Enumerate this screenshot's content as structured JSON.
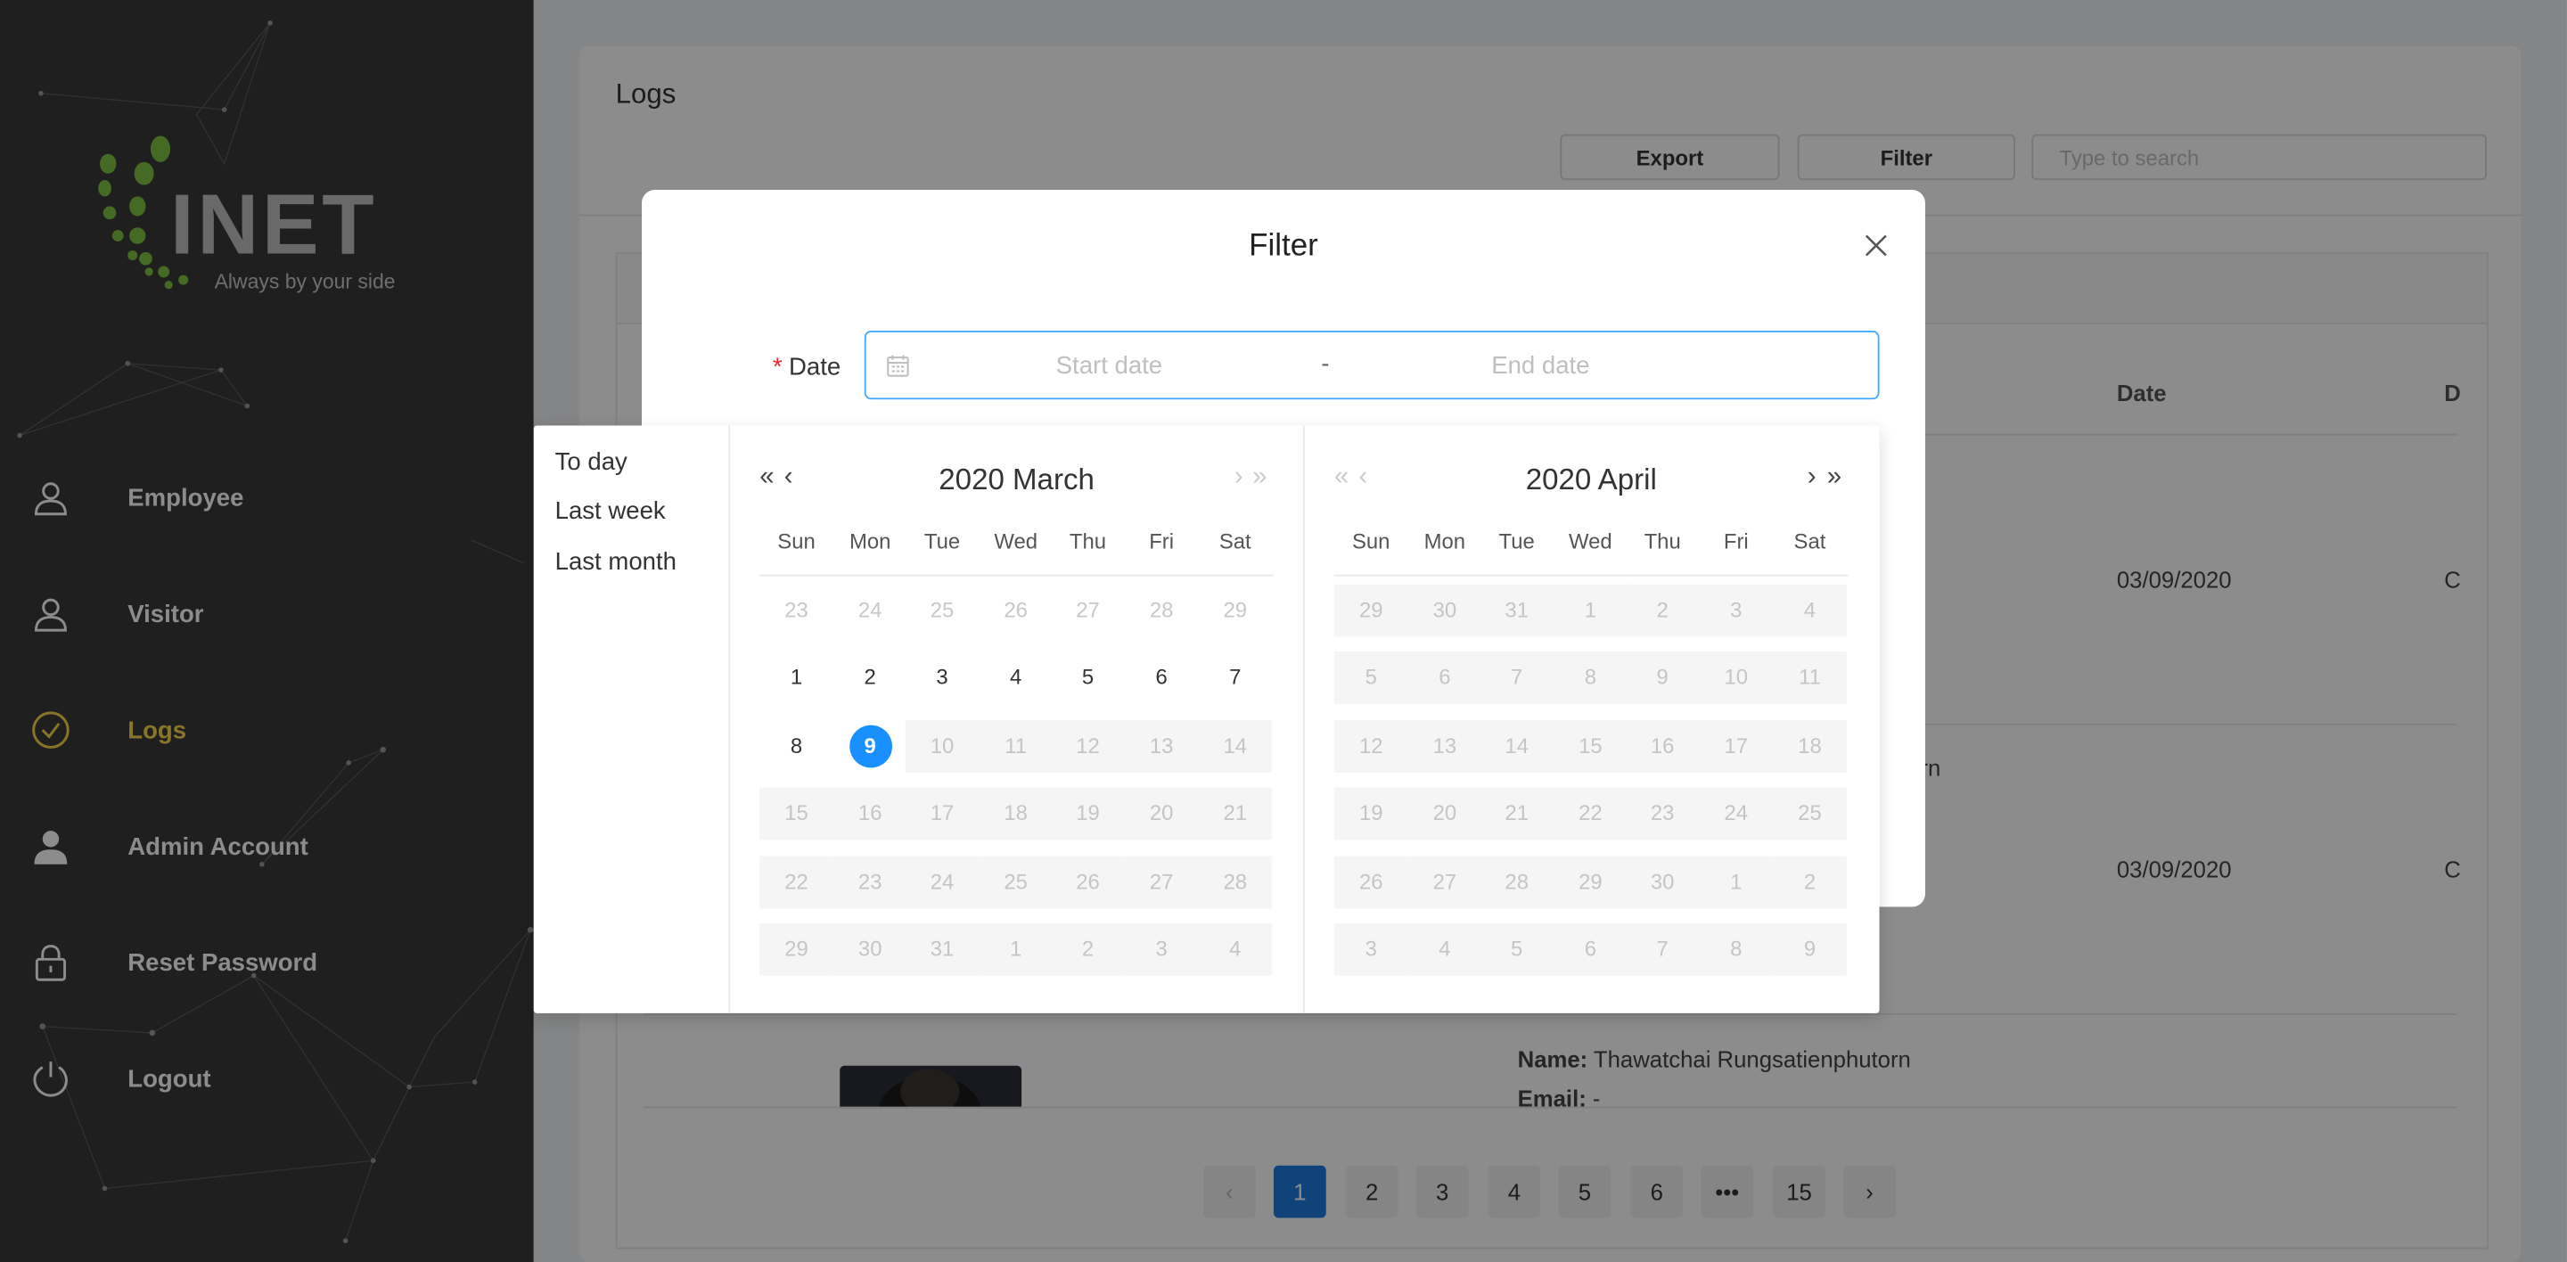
{
  "sidebar": {
    "logo_text": "INET",
    "logo_tagline": "Always by your side",
    "items": [
      {
        "label": "Employee",
        "icon": "user-icon"
      },
      {
        "label": "Visitor",
        "icon": "user-icon"
      },
      {
        "label": "Logs",
        "icon": "check-circle-icon",
        "active": true
      },
      {
        "label": "Admin Account",
        "icon": "admin-user-icon"
      },
      {
        "label": "Reset Password",
        "icon": "lock-icon"
      },
      {
        "label": "Logout",
        "icon": "power-icon"
      }
    ],
    "colors": {
      "background": "#3a3a3a",
      "active": "#f7d64a"
    }
  },
  "page": {
    "title": "Logs",
    "export_label": "Export",
    "filter_label": "Filter",
    "search_placeholder": "Type to search"
  },
  "table": {
    "columns": {
      "date": "Date",
      "d": "D"
    },
    "rows": [
      {
        "date": "03/09/2020",
        "d": "C"
      },
      {
        "date": "03/09/2020",
        "d": "C",
        "name_fragment": "rn"
      },
      {
        "name_label": "Name:",
        "name": "Thawatchai Rungsatienphutorn",
        "email_label": "Email:",
        "email": "-"
      }
    ]
  },
  "pagination": {
    "pages": [
      "1",
      "2",
      "3",
      "4",
      "5",
      "6",
      "•••",
      "15"
    ],
    "current": "1"
  },
  "modal": {
    "title": "Filter",
    "date_label": "Date",
    "start_placeholder": "Start date",
    "end_placeholder": "End date",
    "separator": "-"
  },
  "picker": {
    "presets": [
      "To day",
      "Last week",
      "Last month"
    ],
    "weekdays": [
      "Sun",
      "Mon",
      "Tue",
      "Wed",
      "Thu",
      "Fri",
      "Sat"
    ],
    "left": {
      "title": "2020 March",
      "weeks": [
        [
          "23",
          "24",
          "25",
          "26",
          "27",
          "28",
          "29"
        ],
        [
          "1",
          "2",
          "3",
          "4",
          "5",
          "6",
          "7"
        ],
        [
          "8",
          "9",
          "10",
          "11",
          "12",
          "13",
          "14"
        ],
        [
          "15",
          "16",
          "17",
          "18",
          "19",
          "20",
          "21"
        ],
        [
          "22",
          "23",
          "24",
          "25",
          "26",
          "27",
          "28"
        ],
        [
          "29",
          "30",
          "31",
          "1",
          "2",
          "3",
          "4"
        ]
      ],
      "selected": "9"
    },
    "right": {
      "title": "2020 April",
      "weeks": [
        [
          "29",
          "30",
          "31",
          "1",
          "2",
          "3",
          "4"
        ],
        [
          "5",
          "6",
          "7",
          "8",
          "9",
          "10",
          "11"
        ],
        [
          "12",
          "13",
          "14",
          "15",
          "16",
          "17",
          "18"
        ],
        [
          "19",
          "20",
          "21",
          "22",
          "23",
          "24",
          "25"
        ],
        [
          "26",
          "27",
          "28",
          "29",
          "30",
          "1",
          "2"
        ],
        [
          "3",
          "4",
          "5",
          "6",
          "7",
          "8",
          "9"
        ]
      ]
    },
    "accent": "#1890ff"
  }
}
